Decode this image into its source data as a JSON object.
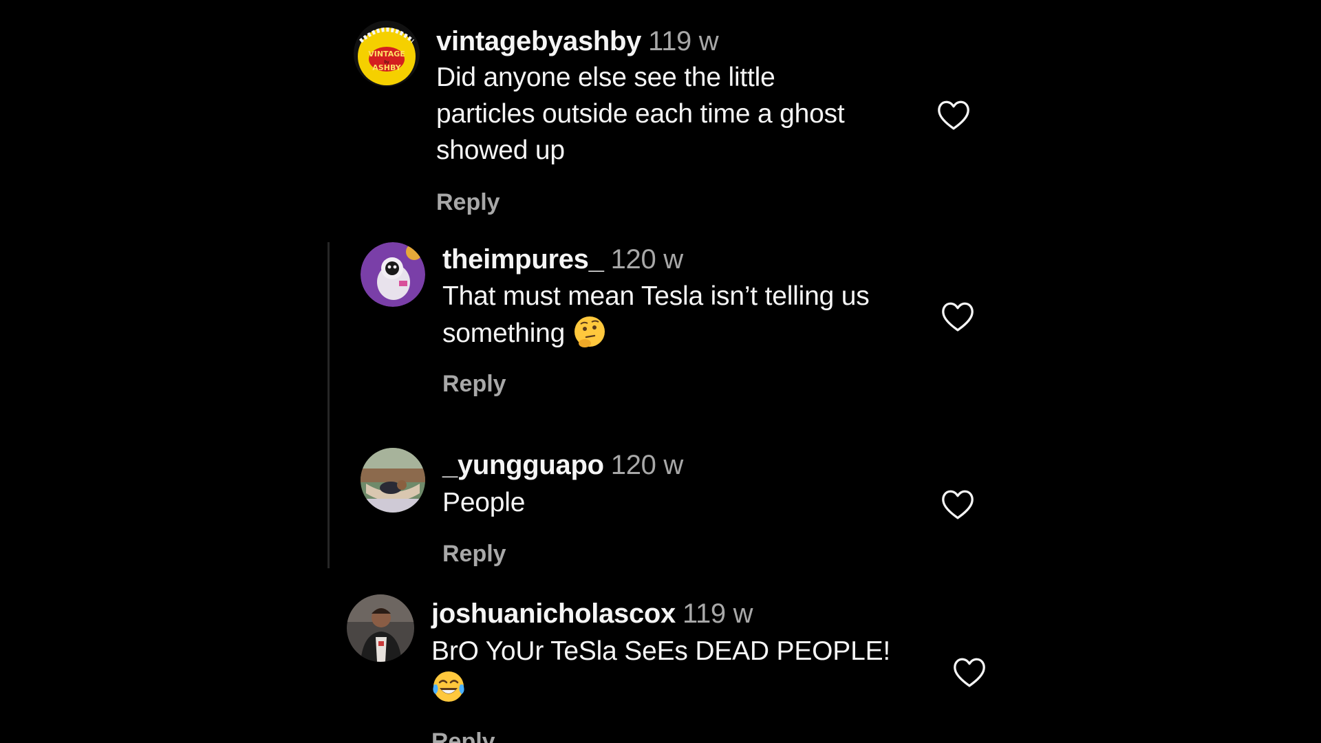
{
  "colors": {
    "background": "#000000",
    "text_primary": "#f5f5f5",
    "text_secondary": "#a8a8a8",
    "thread_line": "#262626"
  },
  "comments": [
    {
      "username": "vintagebyashby",
      "time": "119 w",
      "text_lines": [
        "Did anyone else see the little",
        "particles outside each time a ghost",
        "showed up"
      ],
      "reply_label": "Reply",
      "like_icon": "heart-outline-icon",
      "avatar_text": "VINTAGE by ASHBY"
    },
    {
      "username": "theimpures_",
      "time": "120 w",
      "text_lines": [
        "That must mean Tesla isn’t telling us",
        "something"
      ],
      "emoji": "thinking-face-emoji",
      "reply_label": "Reply",
      "like_icon": "heart-outline-icon"
    },
    {
      "username": "_yungguapo",
      "time": "120 w",
      "text_lines": [
        "People"
      ],
      "reply_label": "Reply",
      "like_icon": "heart-outline-icon"
    },
    {
      "username": "joshuanicholascox",
      "time": "119 w",
      "text_lines": [
        "BrO YoUr TeSla SeEs DEAD PEOPLE!"
      ],
      "emoji": "face-with-tears-of-joy-emoji",
      "reply_label": "Reply",
      "like_icon": "heart-outline-icon"
    }
  ]
}
